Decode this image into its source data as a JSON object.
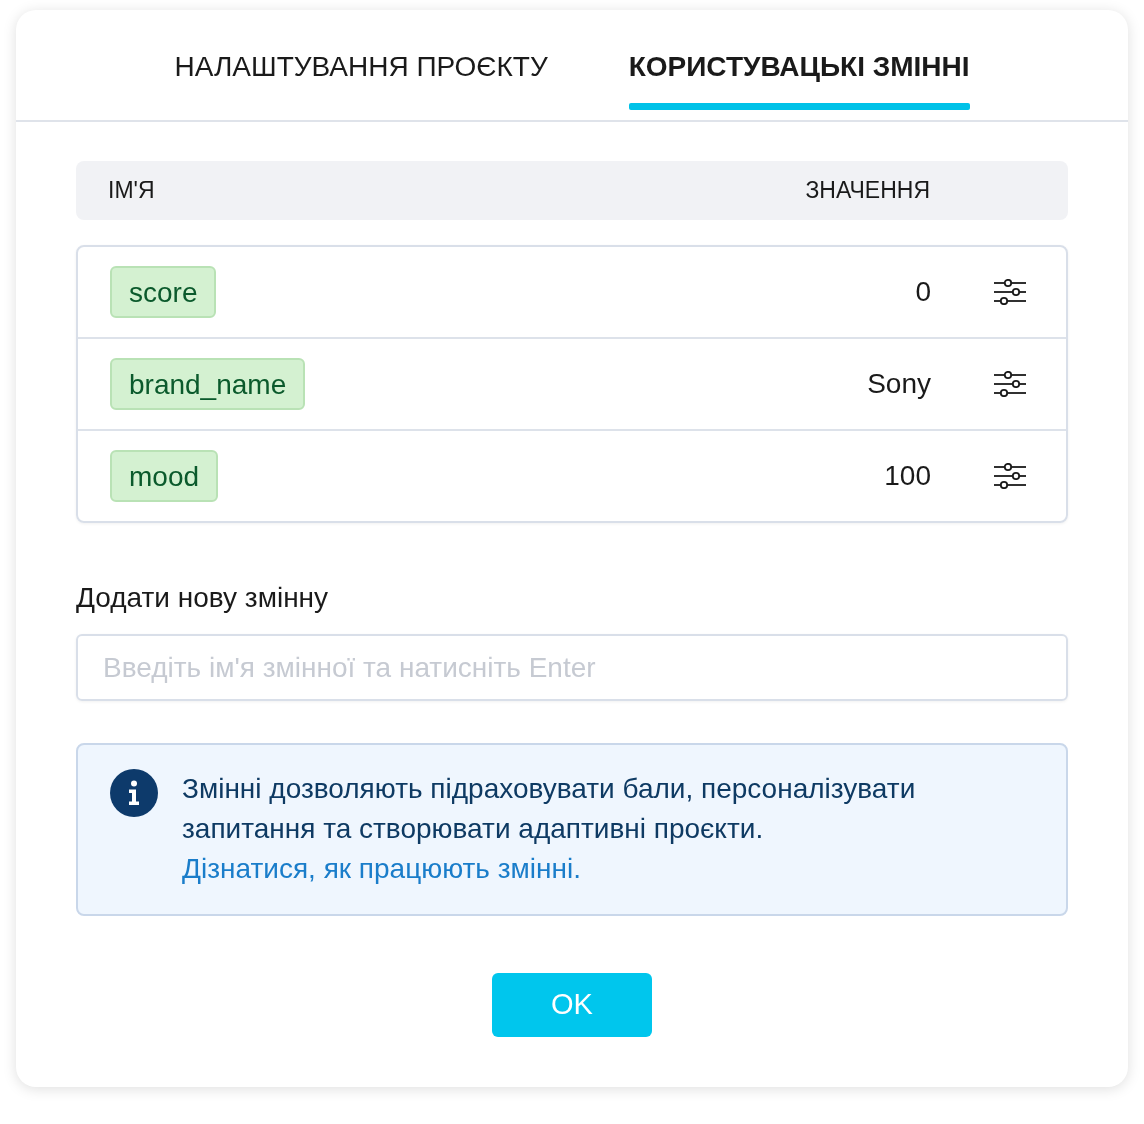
{
  "tabs": [
    {
      "label": "НАЛАШТУВАННЯ ПРОЄКТУ",
      "selected": false
    },
    {
      "label": "КОРИСТУВАЦЬКІ ЗМІННІ",
      "selected": true
    }
  ],
  "table": {
    "columns": [
      "ІМ'Я",
      "ЗНАЧЕННЯ"
    ],
    "rows": [
      {
        "name": "score",
        "value": "0"
      },
      {
        "name": "brand_name",
        "value": "Sony"
      },
      {
        "name": "mood",
        "value": "100"
      }
    ]
  },
  "add_variable": {
    "label": "Додати нову змінну",
    "placeholder": "Введіть ім'я змінної та натисніть Enter"
  },
  "info": {
    "text": "Змінні дозволяють підраховувати бали, персоналізувати запитання та створювати адаптивні проєкти.",
    "link": "Дізнатися, як працюють змінні."
  },
  "buttons": [
    "OK"
  ]
}
